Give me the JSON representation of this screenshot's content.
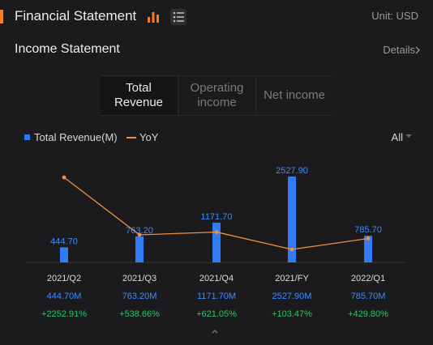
{
  "header": {
    "title": "Financial Statement",
    "unit": "Unit: USD",
    "icons": [
      "bar-chart-icon",
      "list-icon"
    ],
    "accent": "#ff7a1a"
  },
  "section": {
    "title": "Income Statement",
    "details": "Details"
  },
  "tabs": [
    {
      "label": "Total\nRevenue",
      "active": true
    },
    {
      "label": "Operating\nincome",
      "active": false
    },
    {
      "label": "Net income",
      "active": false
    }
  ],
  "legend": {
    "revenue": "Total Revenue(M)",
    "yoy": "YoY",
    "filter": "All"
  },
  "colors": {
    "bar": "#2f7cf6",
    "line": "#f0913a",
    "label": "#3d8bff",
    "positive": "#2cc36b"
  },
  "chart_data": {
    "type": "bar",
    "categories": [
      "2021/Q2",
      "2021/Q3",
      "2021/Q4",
      "2021/FY",
      "2022/Q1"
    ],
    "series": [
      {
        "name": "Total Revenue(M)",
        "type": "bar",
        "values": [
          444.7,
          763.2,
          1171.7,
          2527.9,
          785.7
        ],
        "labels": [
          "444.70",
          "763.20",
          "1171.70",
          "2527.90",
          "785.70"
        ]
      },
      {
        "name": "YoY",
        "type": "line",
        "values": [
          2252.91,
          538.66,
          621.05,
          103.47,
          429.8
        ]
      }
    ]
  },
  "columns": [
    {
      "period": "2021/Q2",
      "revenue": "444.70M",
      "yoy": "+2252.91%"
    },
    {
      "period": "2021/Q3",
      "revenue": "763.20M",
      "yoy": "+538.66%"
    },
    {
      "period": "2021/Q4",
      "revenue": "1171.70M",
      "yoy": "+621.05%"
    },
    {
      "period": "2021/FY",
      "revenue": "2527.90M",
      "yoy": "+103.47%"
    },
    {
      "period": "2022/Q1",
      "revenue": "785.70M",
      "yoy": "+429.80%"
    }
  ]
}
